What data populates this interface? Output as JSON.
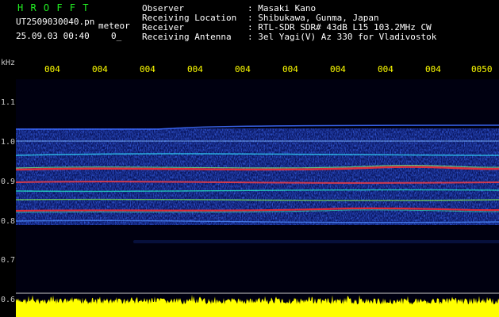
{
  "header": {
    "brand": "H R O F F T",
    "filename": "UT2509030040.pn",
    "mode": "meteor",
    "datetime": "25.09.03 00:40",
    "zero": "0_",
    "fields": [
      {
        "label": "Observer",
        "value": ": Masaki Kano"
      },
      {
        "label": "Receiving Location",
        "value": ": Shibukawa, Gunma, Japan"
      },
      {
        "label": "Receiver",
        "value": ": RTL-SDR SDR# 43dB L15 103.2MHz CW"
      },
      {
        "label": "Receiving Antenna",
        "value": ": 3el Yagi(V) Az 330 for Vladivostok"
      }
    ]
  },
  "axes": {
    "y_unit": "kHz",
    "y_ticks": [
      "1.1",
      "1.0",
      "0.9",
      "0.8",
      "0.7",
      "0.6"
    ],
    "x_ticks": [
      "004",
      "004",
      "004",
      "004",
      "004",
      "004",
      "004",
      "004",
      "004",
      "0050"
    ]
  },
  "colors": {
    "brand": "#22ee22",
    "header_text": "#ffffff",
    "tick_label": "#ffff00",
    "spectrum_fill": "#ffff00"
  }
}
